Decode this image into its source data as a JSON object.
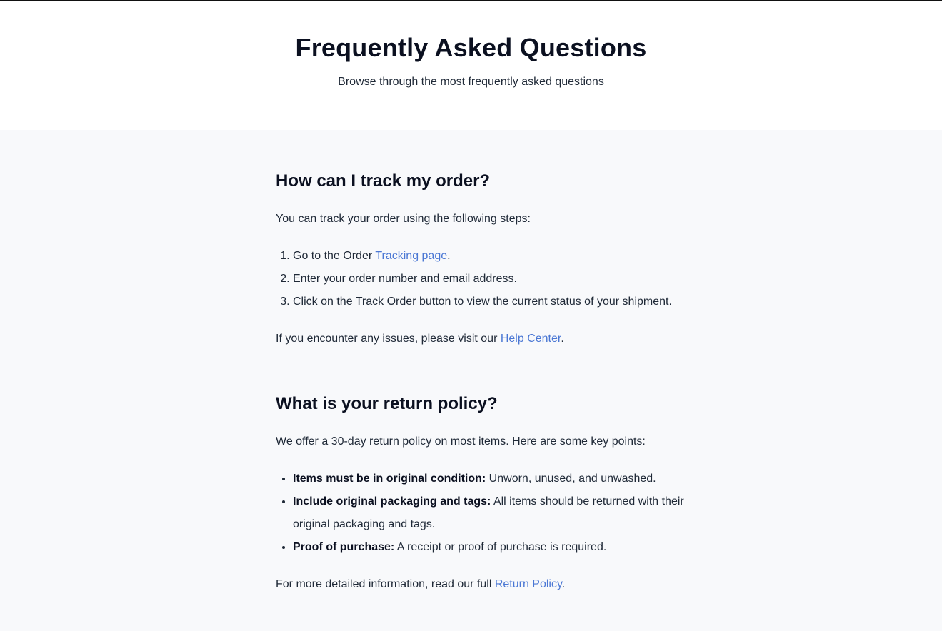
{
  "header": {
    "title": "Frequently Asked Questions",
    "subtitle": "Browse through the most frequently asked questions"
  },
  "faqs": [
    {
      "question": "How can I track my order?",
      "intro": "You can track your order using the following steps:",
      "steps": [
        {
          "before": "Go to the Order ",
          "link": "Tracking page",
          "after": "."
        },
        {
          "text": "Enter your order number and email address."
        },
        {
          "text": "Click on the Track Order button to view the current status of your shipment."
        }
      ],
      "outro": {
        "before": "If you encounter any issues, please visit our ",
        "link": "Help Center",
        "after": "."
      }
    },
    {
      "question": "What is your return policy?",
      "intro": "We offer a 30-day return policy on most items. Here are some key points:",
      "points": [
        {
          "label": "Items must be in original condition:",
          "text": " Unworn, unused, and unwashed."
        },
        {
          "label": "Include original packaging and tags:",
          "text": " All items should be returned with their original packaging and tags."
        },
        {
          "label": "Proof of purchase:",
          "text": " A receipt or proof of purchase is required."
        }
      ],
      "outro": {
        "before": "For more detailed information, read our full ",
        "link": "Return Policy",
        "after": "."
      }
    }
  ],
  "colors": {
    "link": "#4a77d4",
    "section_background": "#f8f9fb",
    "header_background": "#ffffff"
  }
}
